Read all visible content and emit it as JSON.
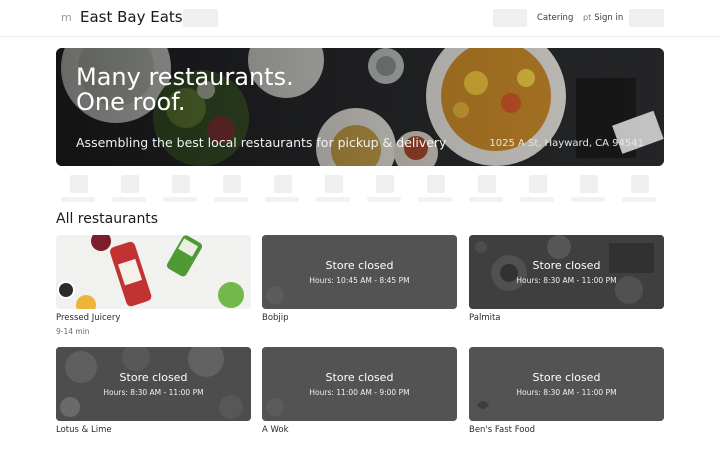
{
  "header": {
    "logo_mark": "m",
    "brand": "East Bay Eats",
    "catering_label": "Catering",
    "signin_icon_glyph": "pt",
    "signin_label": "Sign in"
  },
  "hero": {
    "line1": "Many restaurants.",
    "line2": "One roof.",
    "subtitle": "Assembling the best local restaurants for pickup & delivery",
    "address": "1025 A St, Hayward, CA 94541"
  },
  "section": {
    "title": "All restaurants"
  },
  "restaurants": [
    {
      "name": "Pressed Juicery",
      "status": "",
      "hours": "",
      "eta": "9-14 min"
    },
    {
      "name": "Bobjip",
      "status": "Store closed",
      "hours": "Hours: 10:45 AM - 8:45 PM",
      "eta": ""
    },
    {
      "name": "Palmita",
      "status": "Store closed",
      "hours": "Hours: 8:30 AM - 11:00 PM",
      "eta": ""
    },
    {
      "name": "Lotus & Lime",
      "status": "Store closed",
      "hours": "Hours: 8:30 AM - 11:00 PM",
      "eta": ""
    },
    {
      "name": "A Wok",
      "status": "Store closed",
      "hours": "Hours: 11:00 AM - 9:00 PM",
      "eta": ""
    },
    {
      "name": "Ben's Fast Food",
      "status": "Store closed",
      "hours": "Hours: 8:30 AM - 11:00 PM",
      "eta": ""
    }
  ],
  "colors": {
    "closed_overlay": "#535353",
    "hero_background": "#1b1c1f",
    "placeholder": "#efefef"
  }
}
